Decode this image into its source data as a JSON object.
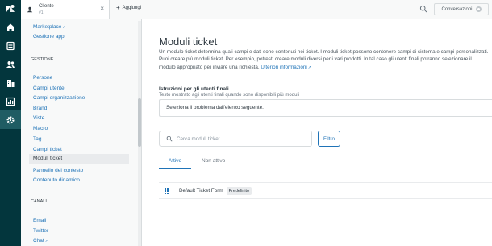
{
  "rail": {
    "icons": [
      "zendesk-logo",
      "home-icon",
      "views-icon",
      "users-icon",
      "organizations-icon",
      "reporting-icon",
      "admin-icon"
    ],
    "active": "admin-icon",
    "background": "#03363d"
  },
  "topbar": {
    "tab_title": "Cliente",
    "tab_subtitle": "#1",
    "add_tab_label": "Aggiungi",
    "conversations_label": "Conversazioni"
  },
  "sidebar": {
    "items_top": [
      {
        "label": "Marketplace",
        "external": true
      },
      {
        "label": "Gestione app",
        "external": false
      }
    ],
    "section_gestione": "GESTIONE",
    "gestione_items": [
      {
        "label": "Persone"
      },
      {
        "label": "Campi utente"
      },
      {
        "label": "Campi organizzazione"
      },
      {
        "label": "Brand"
      },
      {
        "label": "Viste"
      },
      {
        "label": "Macro"
      },
      {
        "label": "Tag"
      },
      {
        "label": "Campi ticket"
      },
      {
        "label": "Moduli ticket"
      },
      {
        "label": "Pannello del contesto"
      },
      {
        "label": "Contenuto dinamico"
      }
    ],
    "selected": "Moduli ticket",
    "section_canali": "CANALI",
    "canali_items": [
      {
        "label": "Email",
        "external": false
      },
      {
        "label": "Twitter",
        "external": false
      },
      {
        "label": "Chat",
        "external": true
      }
    ],
    "ext_glyph": "↗"
  },
  "main": {
    "title": "Moduli ticket",
    "description": "Un modulo ticket determina quali campi e dati sono contenuti nei ticket. I moduli ticket possono contenere campi di sistema e campi personalizzati. Puoi creare più moduli ticket. Per esempio, potresti creare moduli diversi per i vari prodotti. In tal caso gli utenti finali potranno selezionare il modulo appropriato per inviare una richiesta.",
    "more_info_link": "Ulteriori informazioni",
    "instructions_label": "Istruzioni per gli utenti finali",
    "instructions_hint": "Testo mostrato agli utenti finali quando sono disponibili più moduli",
    "instructions_value": "Seleziona il problema dall'elenco seguente.",
    "search_placeholder": "Cerca moduli ticket",
    "filter_label": "Filtro",
    "tab_active": "Attivo",
    "tab_inactive": "Non attivo",
    "forms": [
      {
        "name": "Default Ticket Form",
        "badge": "Predefinito"
      }
    ],
    "accent": "#1f73b7"
  }
}
